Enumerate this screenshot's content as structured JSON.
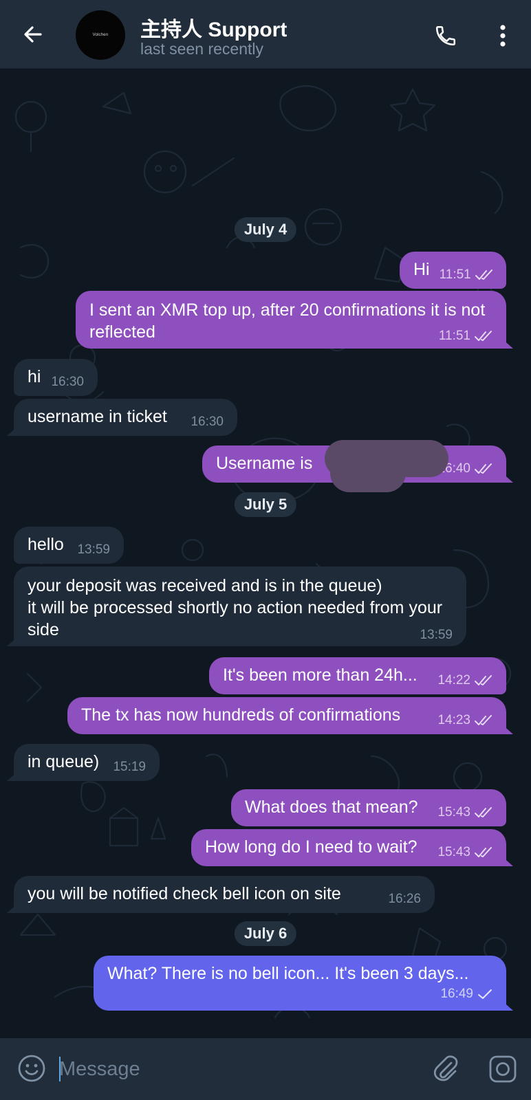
{
  "header": {
    "title": "主持人 Support",
    "status": "last seen recently",
    "avatar_logo": "Volchen",
    "icons": [
      "arrow-left-icon",
      "phone-icon",
      "more-vertical-icon"
    ]
  },
  "dates": [
    "July 4",
    "July 5",
    "July 6"
  ],
  "messages": [
    {
      "direction": "out",
      "text": "Hi",
      "time": "11:51",
      "status": "read"
    },
    {
      "direction": "out",
      "text": "I sent an XMR top up, after 20 confirmations it is not reflected",
      "time": "11:51",
      "status": "read"
    },
    {
      "direction": "in",
      "text": "hi",
      "time": "16:30"
    },
    {
      "direction": "in",
      "text": "username in ticket",
      "time": "16:30"
    },
    {
      "direction": "out",
      "text": "Username is",
      "time": "16:40",
      "status": "read"
    },
    {
      "direction": "in",
      "text": "hello",
      "time": "13:59"
    },
    {
      "direction": "in",
      "text": "your deposit was received and is in the queue)\nit will be processed shortly no action needed from your side",
      "time": "13:59"
    },
    {
      "direction": "out",
      "text": "It's been more than 24h...",
      "time": "14:22",
      "status": "read"
    },
    {
      "direction": "out",
      "text": "The tx has now hundreds of confirmations",
      "time": "14:23",
      "status": "read"
    },
    {
      "direction": "in",
      "text": "in queue)",
      "time": "15:19"
    },
    {
      "direction": "out",
      "text": "What does that mean?",
      "time": "15:43",
      "status": "read"
    },
    {
      "direction": "out",
      "text": "How long do I need to wait?",
      "time": "15:43",
      "status": "read"
    },
    {
      "direction": "in",
      "text": "you will be notified check bell icon on site",
      "time": "16:26"
    },
    {
      "direction": "out",
      "text": "What? There is no bell icon... It's been 3 days...",
      "time": "16:49",
      "status": "sent"
    }
  ],
  "input": {
    "placeholder": "Message",
    "value": ""
  },
  "colors": {
    "header_bg": "#212d3b",
    "chat_bg": "#0f1821",
    "incoming_bubble": "#1f2b38",
    "outgoing_bubble": "#8e4fbf",
    "outgoing_bubble_latest": "#6265ec",
    "muted_text": "#7f91a4"
  }
}
